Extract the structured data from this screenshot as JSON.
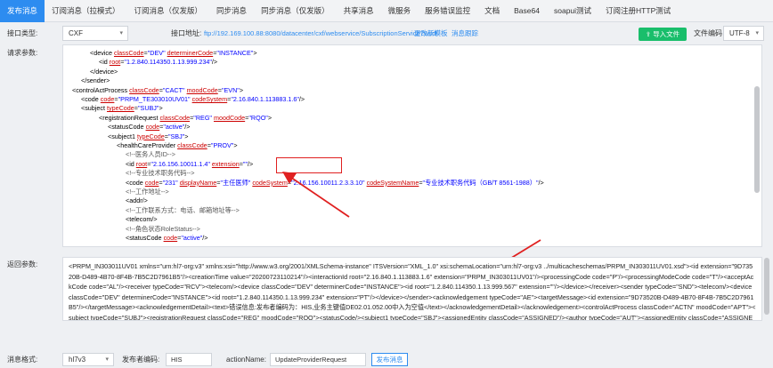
{
  "tabs": [
    {
      "label": "发布消息",
      "active": true
    },
    {
      "label": "订阅消息（拉模式）"
    },
    {
      "label": "订阅消息（仅发版）"
    },
    {
      "label": "同步消息"
    },
    {
      "label": "同步消息（仅发版）"
    },
    {
      "label": "共享消息"
    },
    {
      "label": "微服务"
    },
    {
      "label": "服务错误监控"
    },
    {
      "label": "文档"
    },
    {
      "label": "Base64"
    },
    {
      "label": "soapui测试"
    },
    {
      "label": "订阅注册HTTP测试"
    }
  ],
  "interface": {
    "type_label": "接口类型:",
    "type_value": "CXF",
    "url_label": "接口地址:",
    "url_value": "ftp://192.169.100.88:8080/datacenter/cxf/webservice/SubscriptionService?wsdl",
    "link1": "更改新模板",
    "link2": "消息跟踪",
    "import_label": "导入文件",
    "encoding_label": "文件编码",
    "encoding_value": "UTF-8"
  },
  "request": {
    "label": "请求参数:",
    "lines": [
      {
        "t": "<device classCode=\"DEV\" determinerCode=\"INSTANCE\">"
      },
      {
        "t": "<id root=\"1.2.840.114350.1.13.999.234\"/>"
      },
      {
        "t": "</device>"
      },
      {
        "t": "</sender>"
      },
      {
        "t": "<controlActProcess classCode=\"CACT\" moodCode=\"EVN\">"
      },
      {
        "t": "<code code=\"PRPM_TE303010UV01\" codeSystem=\"2.16.840.1.113883.1.6\"/>"
      },
      {
        "t": "<subject typeCode=\"SUBJ\">"
      },
      {
        "t": "<registrationRequest classCode=\"REG\" moodCode=\"RQO\">"
      },
      {
        "t": "<statusCode code=\"active\"/>"
      },
      {
        "t": "<subject1 typeCode=\"SBJ\">"
      },
      {
        "t": "<healthCareProvider classCode=\"PROV\">"
      },
      {
        "t": "<!--医务人员ID-->"
      },
      {
        "t": "<id root=\"2.16.156.10011.1.4\" extension=\"\"/>"
      },
      {
        "t": "<!--专业技术职务代码-->"
      },
      {
        "t": "<code code=\"231\" displayName=\"主任医师\" codeSystem=\"2.16.156.10011.2.3.3.10\" codeSystemName=\"专业技术职务代码（GB/T 8561-1988）\"/>"
      },
      {
        "t": "<!--工作地址-->"
      },
      {
        "t": "<addr/>"
      },
      {
        "t": "<!--工作联系方式：电话、邮箱地址等-->"
      },
      {
        "t": "<telecom/>"
      },
      {
        "t": "<!--角色状态RoleStatus-->"
      },
      {
        "t": "<statusCode code=\"active\"/>"
      }
    ]
  },
  "response": {
    "label": "返回参数:",
    "text": "<PRPM_IN303011UV01 xmlns=\"urn:hl7-org:v3\" xmlns:xsi=\"http://www.w3.org/2001/XMLSchema-instance\" ITSVersion=\"XML_1.0\" xsi:schemaLocation=\"urn:hl7-org:v3 ../multicacheschemas/PRPM_IN303011UV01.xsd\"><id extension=\"9D73520B-D489-4B70-8F4B-7B5C2D7961B5\"/><creationTime value=\"20200723110214\"/><interactionId root=\"2.16.840.1.113883.1.6\" extension=\"PRPM_IN303011UV01\"/><processingCode code=\"P\"/><processingModeCode code=\"T\"/><acceptAckCode code=\"AL\"/><receiver typeCode=\"RCV\"><telecom/><device classCode=\"DEV\" determinerCode=\"INSTANCE\"><id root=\"1.2.840.114350.1.13.999.567\" extension=\"\"/></device></receiver><sender typeCode=\"SND\"><telecom/><device classCode=\"DEV\" determinerCode=\"INSTANCE\"><id root=\"1.2.840.114350.1.13.999.234\" extension=\"PT\"/></device></sender><acknowledgement typeCode=\"AE\"><targetMessage><id extension=\"9D73520B-D489-4B70-8F4B-7B5C2D7961B5\"/></targetMessage><acknowledgementDetail><text>错误信息:发布者编码为：HIS,业务主键值DE02.01.052.00中入为空值</text></acknowledgementDetail></acknowledgement><controlActProcess classCode=\"ACTN\" moodCode=\"APT\"><subject typeCode=\"SUBJ\"><registrationRequest classCode=\"REG\" moodCode=\"RQO\"><statusCode/><subject1 typeCode=\"SBJ\"><assignedEntity classCode=\"ASSIGNED\"/><author typeCode=\"AUT\"><assignedEntity classCode=\"ASSIGNED\"><id/></assignedEntity></author></registrationRequest></subject></controlActProcess></PRPM_IN303011UV01>"
  },
  "bottom": {
    "format_label": "消息格式:",
    "format_value": "hl7v3",
    "publisher_label": "发布者编码:",
    "publisher_value": "HIS",
    "action_label": "actionName:",
    "action_value": "UpdateProviderRequest",
    "send_label": "发布消息"
  },
  "colors": {
    "accent": "#2d8cf0",
    "success": "#19be6b",
    "annotation": "#e02020"
  }
}
